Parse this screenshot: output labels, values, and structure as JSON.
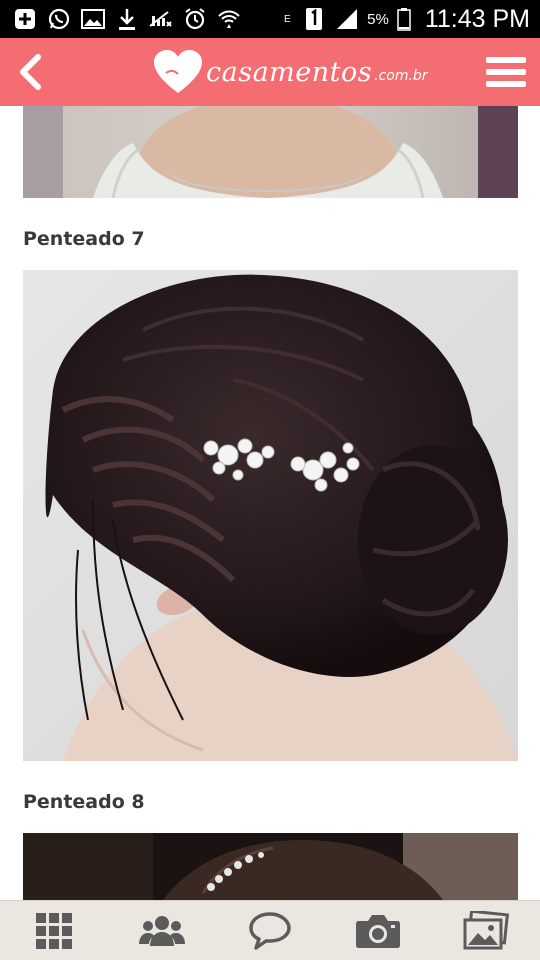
{
  "status_bar": {
    "battery_percent": "5%",
    "time": "11:43 PM",
    "icons": [
      "add-icon",
      "whatsapp-icon",
      "gallery-icon",
      "download-icon",
      "mute-icon",
      "alarm-icon",
      "wifi-icon",
      "edge-icon",
      "sim-icon",
      "signal-icon",
      "battery-icon"
    ]
  },
  "header": {
    "brand_name": "casamentos",
    "brand_suffix": ".com.br",
    "back_icon": "chevron-left-icon",
    "menu_icon": "hamburger-menu-icon",
    "background_color": "#f36d72"
  },
  "content": {
    "items": [
      {
        "caption": "Penteado 7"
      },
      {
        "caption": "Penteado 8"
      }
    ]
  },
  "bottom_nav": {
    "items": [
      {
        "icon": "grid-icon"
      },
      {
        "icon": "community-icon"
      },
      {
        "icon": "chat-bubble-icon"
      },
      {
        "icon": "camera-icon"
      },
      {
        "icon": "photos-icon"
      }
    ]
  }
}
